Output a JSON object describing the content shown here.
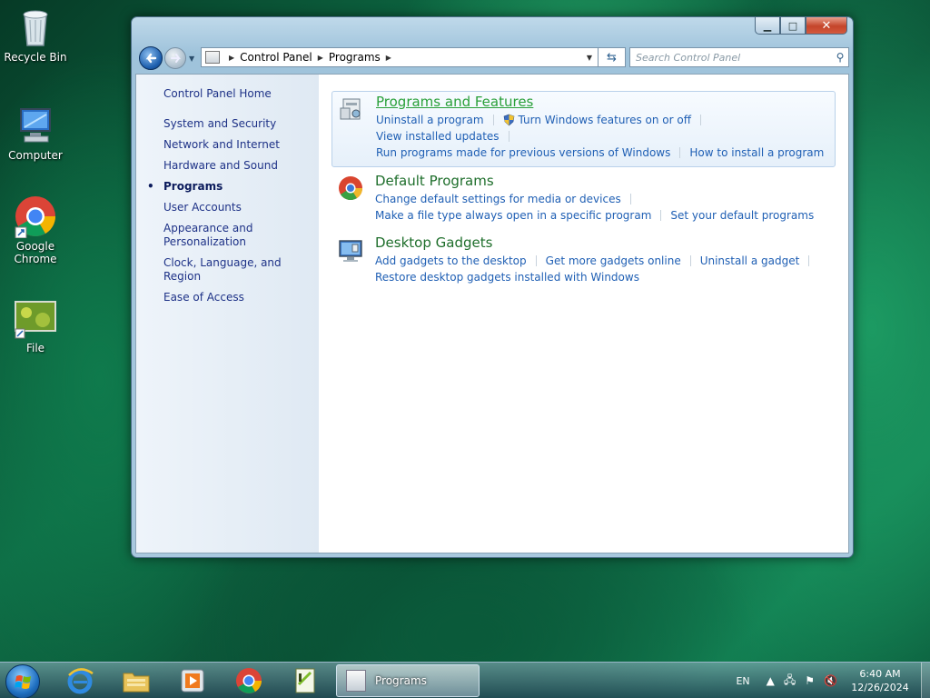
{
  "desktop": {
    "icons": [
      {
        "label": "Recycle Bin"
      },
      {
        "label": "Computer"
      },
      {
        "label": "Google Chrome"
      },
      {
        "label": "File"
      }
    ]
  },
  "window": {
    "controls": {
      "minimize": "▁",
      "maximize": "□",
      "close": "✕"
    },
    "address": {
      "segments": [
        "Control Panel",
        "Programs"
      ]
    },
    "search": {
      "placeholder": "Search Control Panel"
    },
    "sidebar": {
      "home": "Control Panel Home",
      "items": [
        "System and Security",
        "Network and Internet",
        "Hardware and Sound",
        "Programs",
        "User Accounts",
        "Appearance and Personalization",
        "Clock, Language, and Region",
        "Ease of Access"
      ],
      "active_index": 3
    },
    "categories": [
      {
        "title": "Programs and Features",
        "rows": [
          [
            "Uninstall a program",
            "Turn Windows features on or off",
            "View installed updates"
          ],
          [
            "Run programs made for previous versions of Windows",
            "How to install a program"
          ]
        ]
      },
      {
        "title": "Default Programs",
        "rows": [
          [
            "Change default settings for media or devices"
          ],
          [
            "Make a file type always open in a specific program",
            "Set your default programs"
          ]
        ]
      },
      {
        "title": "Desktop Gadgets",
        "rows": [
          [
            "Add gadgets to the desktop",
            "Get more gadgets online",
            "Uninstall a gadget"
          ],
          [
            "Restore desktop gadgets installed with Windows"
          ]
        ]
      }
    ]
  },
  "taskbar": {
    "active_task": "Programs",
    "tray": {
      "language": "EN",
      "time": "6:40 AM",
      "date": "12/26/2024"
    }
  }
}
